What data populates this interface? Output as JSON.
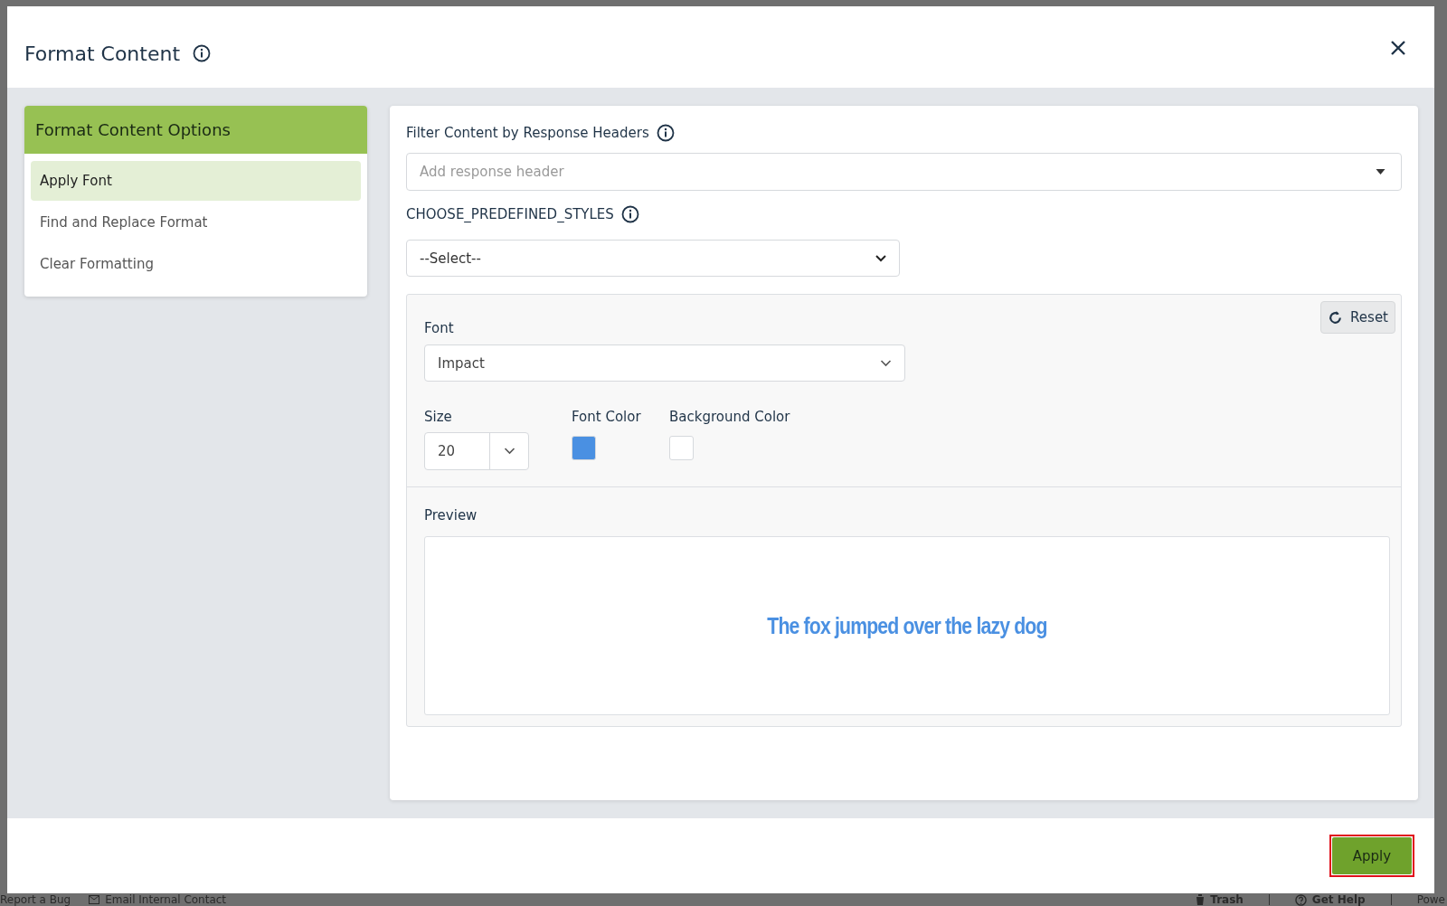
{
  "background": {
    "footer_links": [
      "Report a Bug",
      "Email Internal Contact"
    ],
    "footer_right": [
      "Trash",
      "Get Help",
      "Powe"
    ]
  },
  "dialog": {
    "title": "Format Content",
    "sidebar": {
      "title": "Format Content Options",
      "items": [
        {
          "label": "Apply Font",
          "selected": true
        },
        {
          "label": "Find and Replace Format",
          "selected": false
        },
        {
          "label": "Clear Formatting",
          "selected": false
        }
      ]
    },
    "filter": {
      "label": "Filter Content by Response Headers",
      "placeholder": "Add response header"
    },
    "predefined": {
      "label": "CHOOSE_PREDEFINED_STYLES",
      "value": "--Select--"
    },
    "font": {
      "label": "Font",
      "value": "Impact"
    },
    "reset": "Reset",
    "size": {
      "label": "Size",
      "value": "20"
    },
    "font_color": {
      "label": "Font Color",
      "color": "#4a90e2"
    },
    "background_color": {
      "label": "Background Color",
      "color": "#ffffff"
    },
    "preview": {
      "label": "Preview",
      "text": "The fox jumped over the lazy dog"
    },
    "apply": "Apply"
  }
}
